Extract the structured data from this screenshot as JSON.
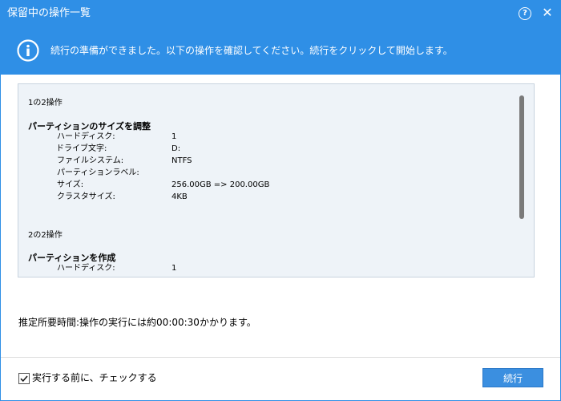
{
  "window": {
    "title": "保留中の操作一覧",
    "help_icon": "help-circle-icon",
    "help_glyph": "?",
    "close_glyph": "✕"
  },
  "banner": {
    "icon": "info-icon",
    "message": "続行の準備ができました。以下の操作を確認してください。続行をクリックして開始します。"
  },
  "operations": [
    {
      "count": "1の2操作",
      "heading": "パーティションのサイズを調整",
      "rows": [
        {
          "label": "ハードディスク:",
          "value": "1"
        },
        {
          "label": "ドライブ文字:",
          "value": "D:"
        },
        {
          "label": "ファイルシステム:",
          "value": "NTFS"
        },
        {
          "label": "パーティションラベル:",
          "value": ""
        },
        {
          "label": "サイズ:",
          "value": "256.00GB => 200.00GB"
        },
        {
          "label": "クラスタサイズ:",
          "value": "4KB"
        }
      ]
    },
    {
      "count": "2の2操作",
      "heading": "パーティションを作成",
      "rows": [
        {
          "label": "ハードディスク:",
          "value": "1"
        }
      ]
    }
  ],
  "estimate": "推定所要時間:操作の実行には約00:00:30かかります。",
  "check_before": {
    "label": "実行する前に、チェックする",
    "checked": true
  },
  "continue_button": "続行",
  "colors": {
    "accent": "#2f8fe6",
    "panel_bg": "#eef3f8",
    "button": "#3b8fe0"
  }
}
